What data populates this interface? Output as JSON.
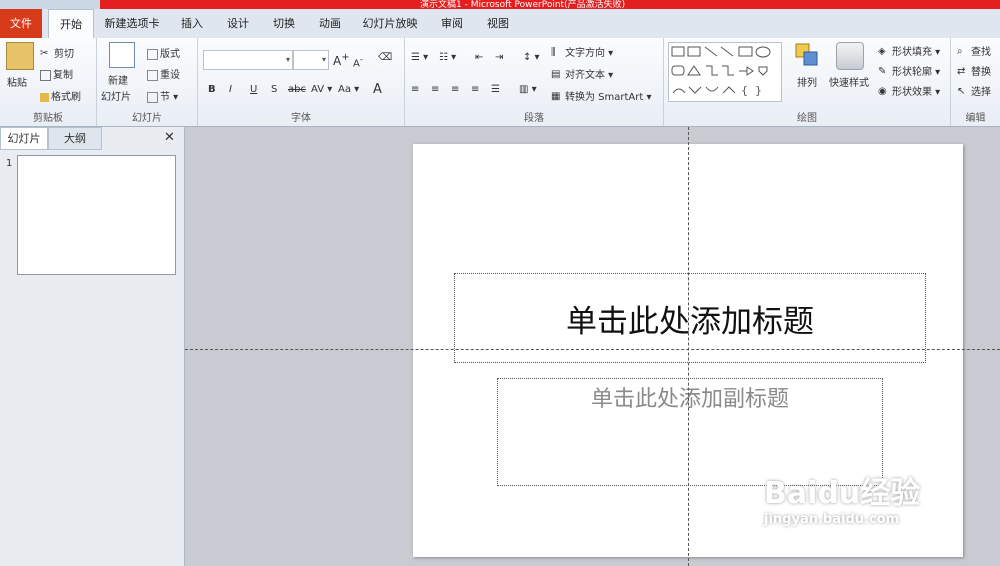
{
  "window": {
    "title": "演示文稿1 - Microsoft PowerPoint(产品激活失败)"
  },
  "tabs": [
    "文件",
    "开始",
    "新建选项卡",
    "插入",
    "设计",
    "切换",
    "动画",
    "幻灯片放映",
    "审阅",
    "视图"
  ],
  "ribbon": {
    "clipboard": {
      "paste": "粘贴",
      "cut": "剪切",
      "copy": "复制",
      "format_painter": "格式刷",
      "label": "剪贴板"
    },
    "slides": {
      "new_slide_line1": "新建",
      "new_slide_line2": "幻灯片",
      "layout": "版式",
      "reset": "重设",
      "section": "节",
      "label": "幻灯片"
    },
    "font": {
      "label": "字体"
    },
    "paragraph": {
      "text_direction": "文字方向",
      "align_text": "对齐文本",
      "convert_smartart": "转换为 SmartArt",
      "label": "段落"
    },
    "drawing": {
      "arrange": "排列",
      "quick_styles": "快速样式",
      "shape_fill": "形状填充",
      "shape_outline": "形状轮廓",
      "shape_effects": "形状效果",
      "label": "绘图"
    },
    "editing": {
      "find": "查找",
      "replace": "替换",
      "select": "选择",
      "label": "编辑"
    }
  },
  "panel": {
    "tab_slides": "幻灯片",
    "tab_outline": "大纲",
    "close": "✕",
    "slide_number": "1"
  },
  "slide": {
    "title_placeholder": "单击此处添加标题",
    "subtitle_placeholder": "单击此处添加副标题"
  },
  "watermark": {
    "brand": "Baidu经验",
    "url": "jingyan.baidu.com"
  }
}
